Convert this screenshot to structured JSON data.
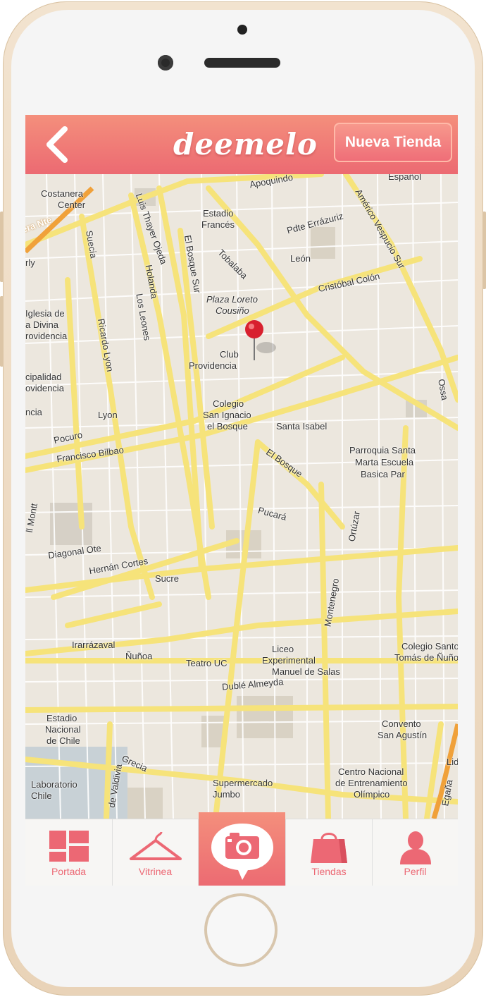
{
  "app": {
    "logo": "deemelo"
  },
  "header": {
    "back_icon": "chevron-left-icon",
    "new_store_label": "Nueva Tienda"
  },
  "colors": {
    "accent": "#ec6a72",
    "accent_light": "#f48f7c",
    "road": "#f6e37a",
    "map_bg": "#ece7de"
  },
  "map": {
    "labels": [
      {
        "text": "Costanera"
      },
      {
        "text": "Center"
      },
      {
        "text": "Apoquindo"
      },
      {
        "text": "Español"
      },
      {
        "text": "Estadio"
      },
      {
        "text": "Francés"
      },
      {
        "text": "Pdte Errázuriz"
      },
      {
        "text": "Américo Vespucio Sur"
      },
      {
        "text": "Luis Thayer Ojeda"
      },
      {
        "text": "Suecia"
      },
      {
        "text": "Holanda"
      },
      {
        "text": "El Bosque Sur"
      },
      {
        "text": "Tobalaba"
      },
      {
        "text": "León"
      },
      {
        "text": "Cristóbal Colón"
      },
      {
        "text": "Los Leones"
      },
      {
        "text": "Plaza Loreto"
      },
      {
        "text": "Cousiño"
      },
      {
        "text": "Club"
      },
      {
        "text": "Providencia"
      },
      {
        "text": "Iglesia de"
      },
      {
        "text": "a Divina"
      },
      {
        "text": "rovidencia"
      },
      {
        "text": "Ricardo Lyon"
      },
      {
        "text": "cipalidad"
      },
      {
        "text": "ovidencia"
      },
      {
        "text": "ncia"
      },
      {
        "text": "Lyon"
      },
      {
        "text": "Colegio"
      },
      {
        "text": "San Ignacio"
      },
      {
        "text": "el Bosque"
      },
      {
        "text": "Santa Isabel"
      },
      {
        "text": "Ossa"
      },
      {
        "text": "Pocuro"
      },
      {
        "text": "Francisco Bilbao"
      },
      {
        "text": "El Bosque"
      },
      {
        "text": "Parroquia Santa"
      },
      {
        "text": "Marta Escuela"
      },
      {
        "text": "Basica Par"
      },
      {
        "text": "Pucará"
      },
      {
        "text": "Ortúzar"
      },
      {
        "text": "Diagonal Ote"
      },
      {
        "text": "Hernán Cortes"
      },
      {
        "text": "Sucre"
      },
      {
        "text": "Montenegro"
      },
      {
        "text": "Irarrázaval"
      },
      {
        "text": "Ñuñoa"
      },
      {
        "text": "Teatro UC"
      },
      {
        "text": "Liceo"
      },
      {
        "text": "Experimental"
      },
      {
        "text": "Manuel de Salas"
      },
      {
        "text": "Colegio Santo"
      },
      {
        "text": "Tomás de Ñuñoa"
      },
      {
        "text": "Dublé Almeyda"
      },
      {
        "text": "Estadio"
      },
      {
        "text": "Nacional"
      },
      {
        "text": "de Chile"
      },
      {
        "text": "Convento"
      },
      {
        "text": "San Agustín"
      },
      {
        "text": "Grecia"
      },
      {
        "text": "Laboratorio"
      },
      {
        "text": "Chile"
      },
      {
        "text": "Supermercado"
      },
      {
        "text": "Jumbo"
      },
      {
        "text": "Centro Nacional"
      },
      {
        "text": "de Entrenamiento"
      },
      {
        "text": "Olímpico"
      },
      {
        "text": "Lid"
      },
      {
        "text": "Egaña"
      },
      {
        "text": "de Valdivia"
      },
      {
        "text": "era Nte"
      },
      {
        "text": "rly"
      },
      {
        "text": "ll Montt"
      }
    ]
  },
  "tabs": [
    {
      "label": "Portada",
      "icon": "dashboard-grid-icon"
    },
    {
      "label": "Vitrinea",
      "icon": "hanger-icon"
    },
    {
      "label": "",
      "icon": "camera-icon"
    },
    {
      "label": "Tiendas",
      "icon": "shopping-bag-icon"
    },
    {
      "label": "Perfil",
      "icon": "user-icon"
    }
  ]
}
